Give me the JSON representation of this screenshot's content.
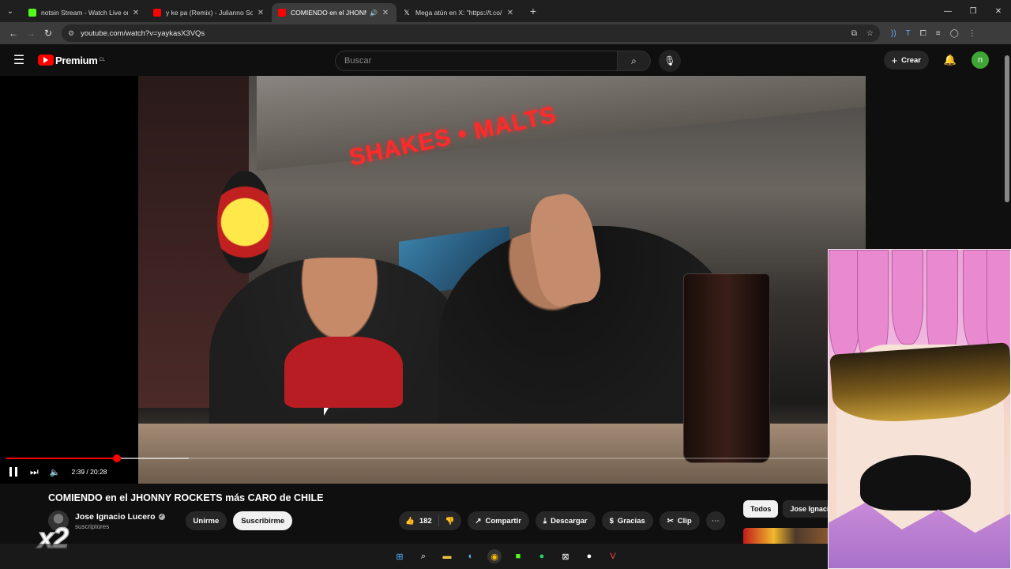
{
  "browser": {
    "tabs": [
      {
        "title": "notsin Stream - Watch Live on",
        "favicon_color": "#53fc18",
        "active": false
      },
      {
        "title": "y ke pa (Remix) - Julianno Sosa",
        "favicon_color": "#ff0000",
        "active": false
      },
      {
        "title": "COMIENDO en el JHONNY",
        "favicon_color": "#ff0000",
        "active": true
      },
      {
        "title": "Mega atún en X: \"https://t.co/",
        "favicon_color": "#ffffff",
        "active": false
      }
    ],
    "url": "youtube.com/watch?v=yaykasX3VQs"
  },
  "youtube": {
    "logo_text": "Premium",
    "region": "CL",
    "search_placeholder": "Buscar",
    "create_label": "Crear",
    "avatar_letter": "n"
  },
  "video_frame": {
    "sign_text": "SHAKES • MALTS"
  },
  "player": {
    "time_display": "2:39 / 20:28",
    "played_fraction": 0.1295,
    "buffered_fraction": 0.2135
  },
  "video": {
    "title": "COMIENDO en el JHONNY ROCKETS más CARO de CHILE",
    "channel_name": "Jose Ignacio Lucero",
    "subscribers": "suscriptores",
    "join_label": "Unirme",
    "subscribe_label": "Suscribirme",
    "likes": "182",
    "share_label": "Compartir",
    "download_label": "Descargar",
    "thanks_label": "Gracias",
    "clip_label": "Clip"
  },
  "chips": [
    "Todos",
    "Jose Ignacio"
  ],
  "overlay": {
    "badge_text": "x2"
  },
  "colors": {
    "accent": "#ff0000",
    "background": "#0f0f0f",
    "avatar": "#3fa535"
  }
}
